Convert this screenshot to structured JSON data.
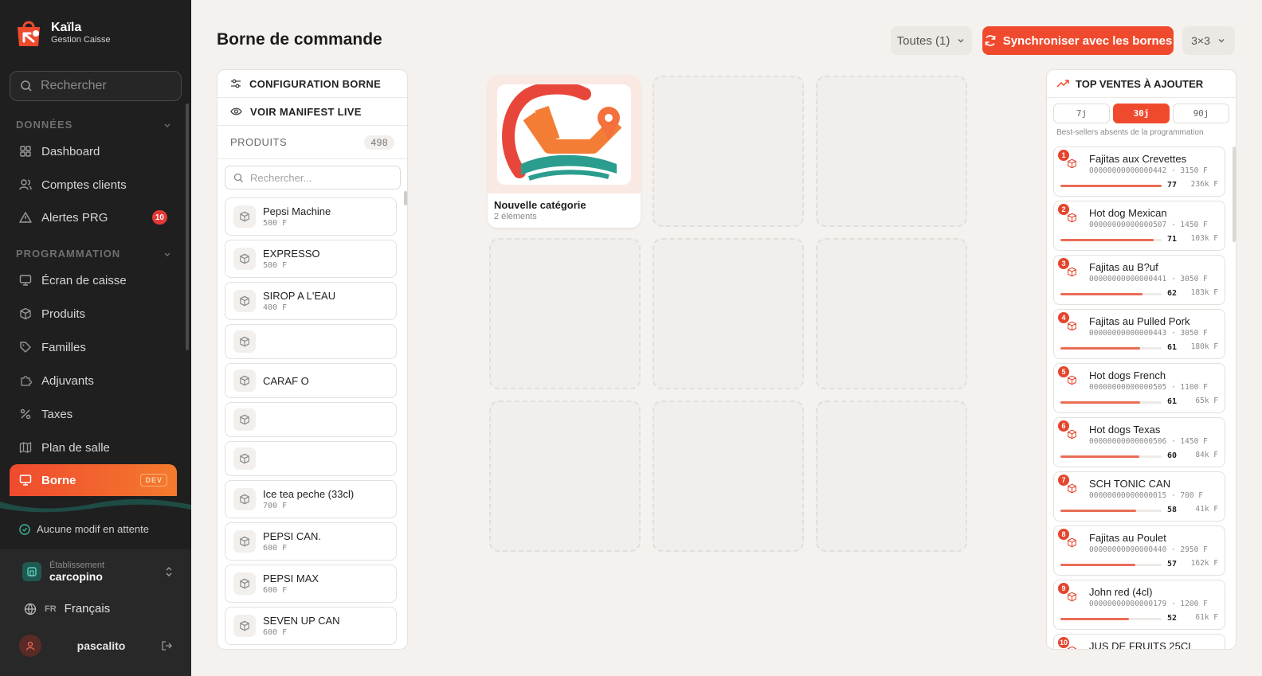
{
  "brand": {
    "name": "Kaïla",
    "subtitle": "Gestion Caisse"
  },
  "sidebar": {
    "search_placeholder": "Rechercher",
    "sections": [
      {
        "label": "DONNÉES",
        "items": [
          {
            "label": "Dashboard",
            "icon": "grid-icon"
          },
          {
            "label": "Comptes clients",
            "icon": "users-icon"
          },
          {
            "label": "Alertes PRG",
            "icon": "alert-icon",
            "badge": "10"
          }
        ]
      },
      {
        "label": "PROGRAMMATION",
        "items": [
          {
            "label": "Écran de caisse",
            "icon": "monitor-icon"
          },
          {
            "label": "Produits",
            "icon": "box-icon"
          },
          {
            "label": "Familles",
            "icon": "tag-icon"
          },
          {
            "label": "Adjuvants",
            "icon": "puzzle-icon"
          },
          {
            "label": "Taxes",
            "icon": "percent-icon"
          },
          {
            "label": "Plan de salle",
            "icon": "map-icon"
          },
          {
            "label": "Borne",
            "icon": "monitor-icon",
            "tag": "DEV",
            "active": true
          }
        ]
      }
    ],
    "pending": "Aucune modif en attente",
    "establishment_label": "Établissement",
    "establishment_name": "carcopino",
    "lang_code": "FR",
    "lang_name": "Français",
    "user_name": "pascalito"
  },
  "header": {
    "title": "Borne de commande",
    "filter_label": "Toutes (1)",
    "sync_label": "Synchroniser avec les bornes",
    "grid_label": "3×3"
  },
  "left_panel": {
    "config_label": "CONFIGURATION BORNE",
    "manifest_label": "VOIR MANIFEST LIVE",
    "products_label": "PRODUITS",
    "products_count": "498",
    "search_placeholder": "Rechercher...",
    "products": [
      {
        "name": "Pepsi Machine",
        "price": "500 F"
      },
      {
        "name": "EXPRESSO",
        "price": "500 F"
      },
      {
        "name": "SIROP A L'EAU",
        "price": "400 F"
      },
      {
        "name": "",
        "price": ""
      },
      {
        "name": "CARAF O",
        "price": ""
      },
      {
        "name": "",
        "price": ""
      },
      {
        "name": "",
        "price": ""
      },
      {
        "name": "Ice tea peche (33cl)",
        "price": "700 F"
      },
      {
        "name": "PEPSI CAN.",
        "price": "600 F"
      },
      {
        "name": "PEPSI MAX",
        "price": "600 F"
      },
      {
        "name": "SEVEN UP CAN",
        "price": "600 F"
      }
    ]
  },
  "grid": {
    "category": {
      "name": "Nouvelle catégorie",
      "count": "2 éléments"
    }
  },
  "right_panel": {
    "title": "TOP VENTES À AJOUTER",
    "periods": [
      {
        "label": "7j",
        "active": false
      },
      {
        "label": "30j",
        "active": true
      },
      {
        "label": "90j",
        "active": false
      }
    ],
    "subtitle": "Best-sellers absents de la programmation",
    "items": [
      {
        "rank": "1",
        "name": "Fajitas aux Crevettes",
        "code": "00000000000000442",
        "price": "3150 F",
        "qty": "77",
        "revenue": "236k F",
        "ratio": 1.0
      },
      {
        "rank": "2",
        "name": "Hot dog Mexican",
        "code": "00000000000000507",
        "price": "1450 F",
        "qty": "71",
        "revenue": "103k F",
        "ratio": 0.92
      },
      {
        "rank": "3",
        "name": "Fajitas au B?uf",
        "code": "00000000000000441",
        "price": "3050 F",
        "qty": "62",
        "revenue": "183k F",
        "ratio": 0.81
      },
      {
        "rank": "4",
        "name": "Fajitas au Pulled Pork",
        "code": "00000000000000443",
        "price": "3050 F",
        "qty": "61",
        "revenue": "180k F",
        "ratio": 0.79
      },
      {
        "rank": "5",
        "name": "Hot dogs French",
        "code": "00000000000000505",
        "price": "1100 F",
        "qty": "61",
        "revenue": "65k F",
        "ratio": 0.79
      },
      {
        "rank": "6",
        "name": "Hot dogs Texas",
        "code": "00000000000000506",
        "price": "1450 F",
        "qty": "60",
        "revenue": "84k F",
        "ratio": 0.78
      },
      {
        "rank": "7",
        "name": "SCH TONIC CAN",
        "code": "00000000000000015",
        "price": "700 F",
        "qty": "58",
        "revenue": "41k F",
        "ratio": 0.75
      },
      {
        "rank": "8",
        "name": "Fajitas au Poulet",
        "code": "00000000000000440",
        "price": "2950 F",
        "qty": "57",
        "revenue": "162k F",
        "ratio": 0.74
      },
      {
        "rank": "9",
        "name": "John red (4cl)",
        "code": "00000000000000179",
        "price": "1200 F",
        "qty": "52",
        "revenue": "61k F",
        "ratio": 0.68
      },
      {
        "rank": "10",
        "name": "JUS DE FRUITS 25CL",
        "code": "",
        "price": "",
        "qty": "",
        "revenue": "",
        "ratio": 0
      }
    ]
  },
  "colors": {
    "accent": "#f04a2e",
    "sidebar_bg": "#1f1f1f",
    "page_bg": "#f5f1ee"
  }
}
